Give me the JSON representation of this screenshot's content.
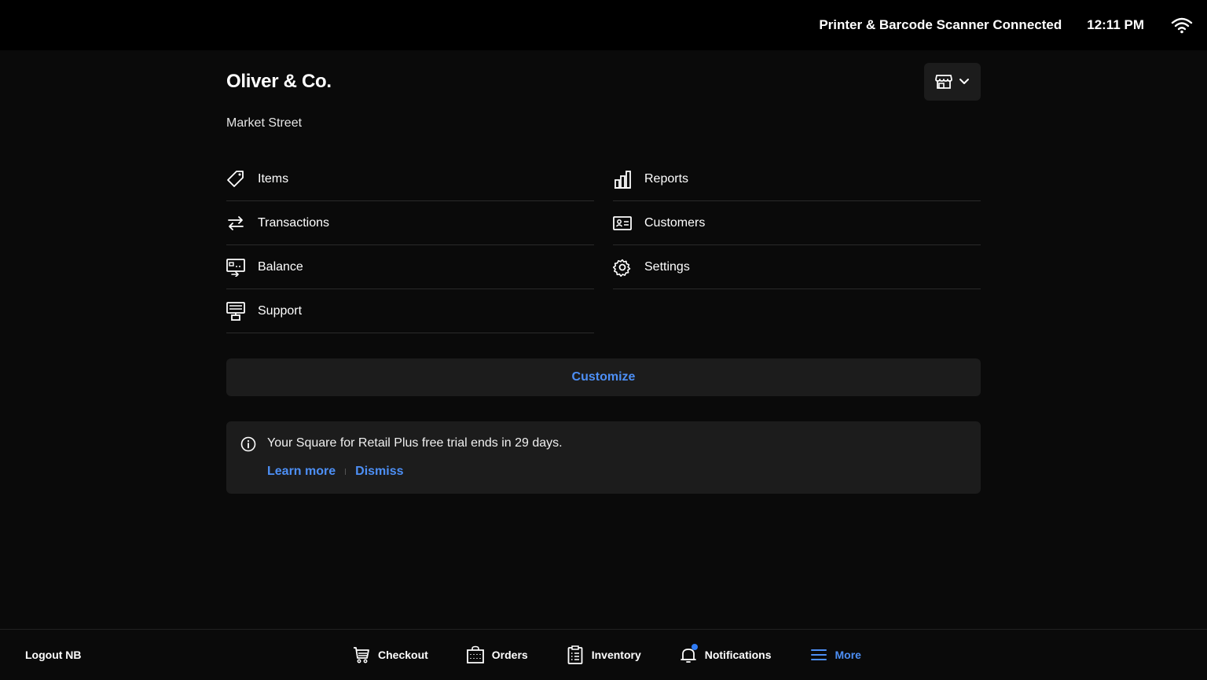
{
  "status_bar": {
    "connection": "Printer & Barcode Scanner Connected",
    "time": "12:11 PM"
  },
  "header": {
    "business_name": "Oliver & Co.",
    "location": "Market Street"
  },
  "menu": {
    "left": [
      {
        "label": "Items",
        "icon": "tag-icon"
      },
      {
        "label": "Transactions",
        "icon": "arrows-icon"
      },
      {
        "label": "Balance",
        "icon": "balance-icon"
      },
      {
        "label": "Support",
        "icon": "support-icon"
      }
    ],
    "right": [
      {
        "label": "Reports",
        "icon": "bar-chart-icon"
      },
      {
        "label": "Customers",
        "icon": "id-card-icon"
      },
      {
        "label": "Settings",
        "icon": "gear-icon"
      }
    ]
  },
  "customize_label": "Customize",
  "banner": {
    "message": "Your Square for Retail Plus free trial ends in 29 days.",
    "learn_more": "Learn more",
    "dismiss": "Dismiss"
  },
  "bottom_bar": {
    "logout": "Logout NB",
    "tabs": [
      {
        "label": "Checkout",
        "icon": "cart-icon"
      },
      {
        "label": "Orders",
        "icon": "bag-icon"
      },
      {
        "label": "Inventory",
        "icon": "clipboard-icon"
      },
      {
        "label": "Notifications",
        "icon": "bell-icon"
      },
      {
        "label": "More",
        "icon": "menu-icon"
      }
    ]
  },
  "colors": {
    "accent": "#4d8ff5",
    "background": "#0a0a0a",
    "card": "#1c1c1c"
  }
}
